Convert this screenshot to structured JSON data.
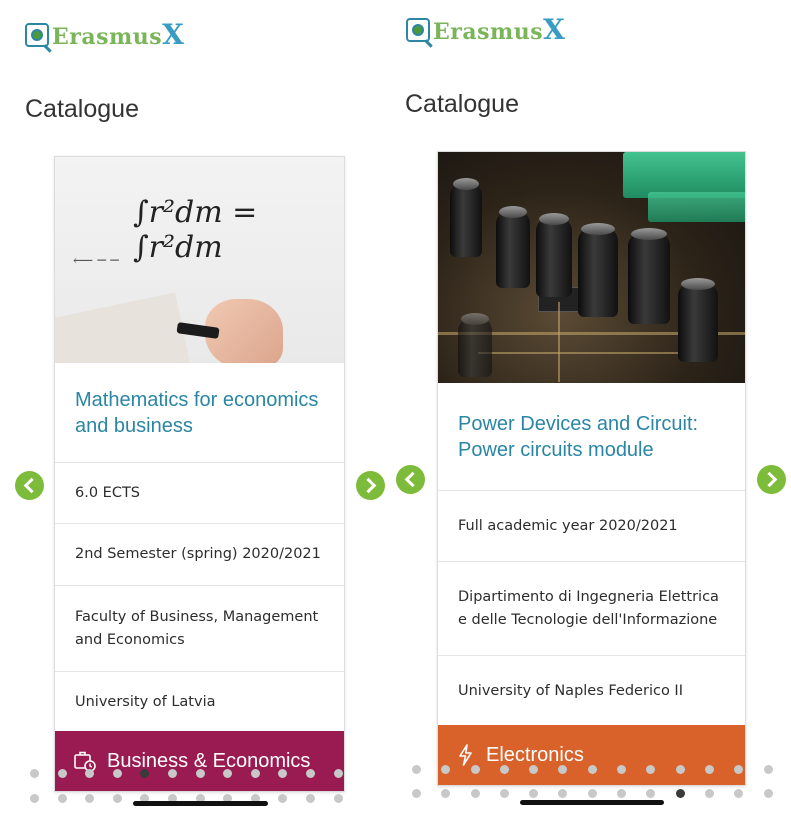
{
  "screens": [
    {
      "logo": {
        "prefix": "Erasmus",
        "suffix": "X"
      },
      "page_title": "Catalogue",
      "card": {
        "image_name": "whiteboard-math-photo",
        "title": "Mathematics for economics and business",
        "rows": [
          "6.0 ECTS",
          "2nd Semester (spring) 2020/2021",
          "Faculty of Business, Management and Economics",
          "University of Latvia"
        ],
        "category": {
          "label": "Business & Economics",
          "icon": "briefcase-clock-icon",
          "color": "#9a1b51"
        }
      },
      "pagination": {
        "total": 24,
        "active": 4
      }
    },
    {
      "logo": {
        "prefix": "Erasmus",
        "suffix": "X"
      },
      "page_title": "Catalogue",
      "card": {
        "image_name": "circuit-board-photo",
        "title": "Power Devices and Circuit: Power circuits module",
        "rows": [
          "Full academic year 2020/2021",
          "Dipartimento di Ingegneria Elettrica e delle Tecnologie dell'Informazione",
          "University of Naples Federico II"
        ],
        "category": {
          "label": "Electronics",
          "icon": "lightning-icon",
          "color": "#d8622a"
        }
      },
      "pagination": {
        "total": 26,
        "active": 22
      }
    }
  ],
  "colors": {
    "accent_title": "#2a86a4",
    "nav_arrow": "#7dbb3a",
    "logo_green": "#7bb55a",
    "logo_blue": "#3a9cc4"
  }
}
